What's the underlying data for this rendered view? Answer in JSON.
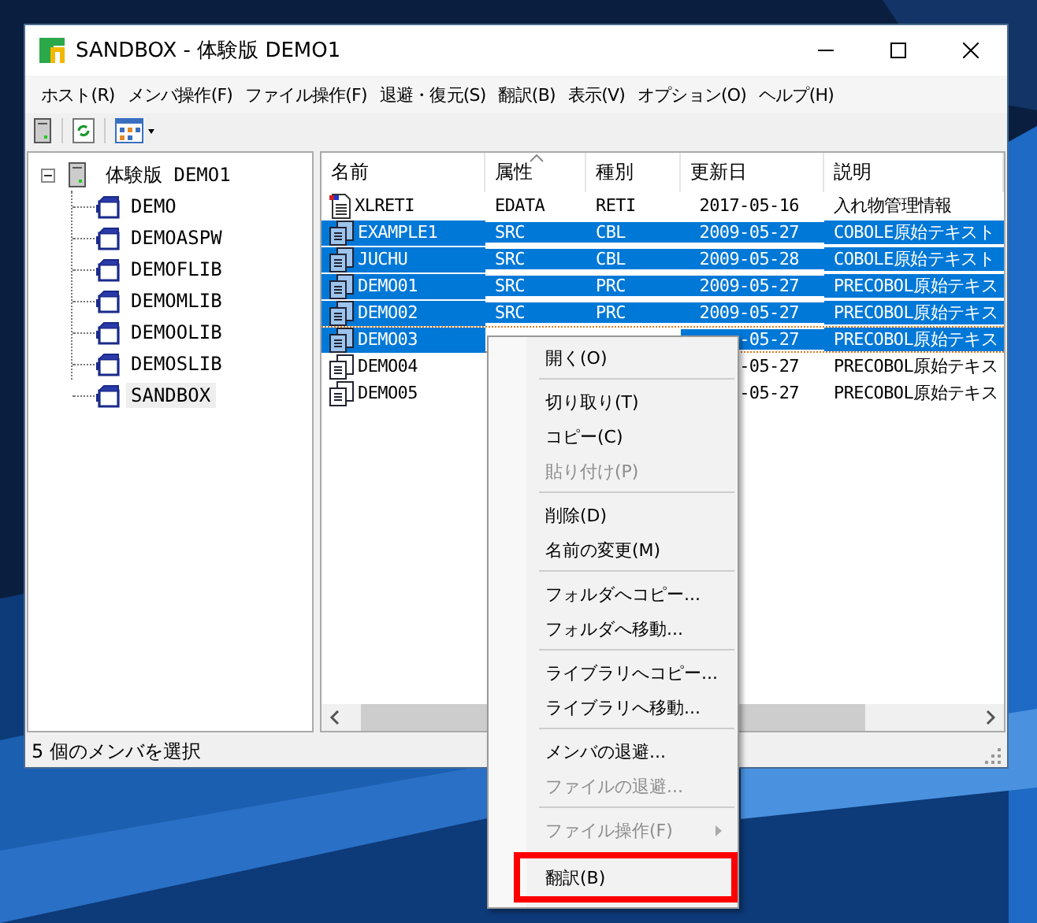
{
  "window": {
    "title": "SANDBOX - 体験版 DEMO1"
  },
  "menu_bar": [
    "ホスト(R)",
    "メンバ操作(F)",
    "ファイル操作(F)",
    "退避・復元(S)",
    "翻訳(B)",
    "表示(V)",
    "オプション(O)",
    "ヘルプ(H)"
  ],
  "tree": {
    "label": "体験版 DEMO1",
    "expanded": true,
    "selected": false,
    "children": [
      {
        "label": "DEMO",
        "selected": false
      },
      {
        "label": "DEMOASPW",
        "selected": false
      },
      {
        "label": "DEMOFLIB",
        "selected": false
      },
      {
        "label": "DEMOMLIB",
        "selected": false
      },
      {
        "label": "DEMOOLIB",
        "selected": false
      },
      {
        "label": "DEMOSLIB",
        "selected": false
      },
      {
        "label": "SANDBOX",
        "selected": true
      }
    ]
  },
  "table": {
    "columns": [
      {
        "label": "名前",
        "sorted": false
      },
      {
        "label": "属性",
        "sorted": true
      },
      {
        "label": "種別",
        "sorted": false
      },
      {
        "label": "更新日",
        "sorted": false
      },
      {
        "label": "説明",
        "sorted": false
      }
    ],
    "rows": [
      {
        "kind": "data",
        "name": "XLRETI",
        "attr": "EDATA",
        "type": "RETI",
        "date": "2017-05-16",
        "desc": "入れ物管理情報",
        "selected": false,
        "focused": false
      },
      {
        "kind": "source",
        "name": "EXAMPLE1",
        "attr": "SRC",
        "type": "CBL",
        "date": "2009-05-27",
        "desc": "COBOLE原始テキスト",
        "selected": true,
        "focused": false
      },
      {
        "kind": "source",
        "name": "JUCHU",
        "attr": "SRC",
        "type": "CBL",
        "date": "2009-05-28",
        "desc": "COBOLE原始テキスト",
        "selected": true,
        "focused": false
      },
      {
        "kind": "source",
        "name": "DEMO01",
        "attr": "SRC",
        "type": "PRC",
        "date": "2009-05-27",
        "desc": "PRECOBOL原始テキス",
        "selected": true,
        "focused": false
      },
      {
        "kind": "source",
        "name": "DEMO02",
        "attr": "SRC",
        "type": "PRC",
        "date": "2009-05-27",
        "desc": "PRECOBOL原始テキス",
        "selected": true,
        "focused": false
      },
      {
        "kind": "source",
        "name": "DEMO03",
        "date": "-05-27",
        "desc": "PRECOBOL原始テキス",
        "selected": true,
        "focused": true
      },
      {
        "kind": "source",
        "name": "DEMO04",
        "date": "-05-27",
        "desc": "PRECOBOL原始テキス",
        "selected": false,
        "focused": false
      },
      {
        "kind": "source",
        "name": "DEMO05",
        "date": "-05-27",
        "desc": "PRECOBOL原始テキス",
        "selected": false,
        "focused": false
      }
    ]
  },
  "status_bar": "5 個のメンバを選択",
  "context_menu": [
    {
      "kind": "item",
      "label": "開く(O)",
      "disabled": false,
      "highlighted": false
    },
    {
      "kind": "separator"
    },
    {
      "kind": "item",
      "label": "切り取り(T)",
      "disabled": false,
      "highlighted": false
    },
    {
      "kind": "item",
      "label": "コピー(C)",
      "disabled": false,
      "highlighted": false
    },
    {
      "kind": "item",
      "label": "貼り付け(P)",
      "disabled": true,
      "highlighted": false
    },
    {
      "kind": "separator"
    },
    {
      "kind": "item",
      "label": "削除(D)",
      "disabled": false,
      "highlighted": false
    },
    {
      "kind": "item",
      "label": "名前の変更(M)",
      "disabled": false,
      "highlighted": false
    },
    {
      "kind": "separator"
    },
    {
      "kind": "item",
      "label": "フォルダへコピー...",
      "disabled": false,
      "highlighted": false
    },
    {
      "kind": "item",
      "label": "フォルダへ移動...",
      "disabled": false,
      "highlighted": false
    },
    {
      "kind": "separator"
    },
    {
      "kind": "item",
      "label": "ライブラリへコピー...",
      "disabled": false,
      "highlighted": false
    },
    {
      "kind": "item",
      "label": "ライブラリへ移動...",
      "disabled": false,
      "highlighted": false
    },
    {
      "kind": "separator"
    },
    {
      "kind": "item",
      "label": "メンバの退避...",
      "disabled": false,
      "highlighted": false
    },
    {
      "kind": "item",
      "label": "ファイルの退避...",
      "disabled": true,
      "highlighted": false
    },
    {
      "kind": "separator"
    },
    {
      "kind": "submenu",
      "label": "ファイル操作(F)",
      "disabled": true,
      "highlighted": false
    },
    {
      "kind": "item",
      "label": "翻訳(B)",
      "disabled": false,
      "highlighted": true
    }
  ]
}
